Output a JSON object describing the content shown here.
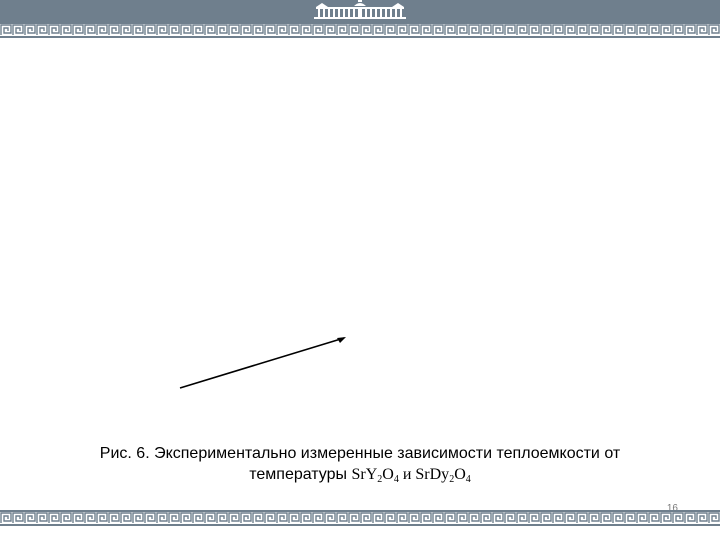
{
  "slide": {
    "caption_line1": "Рис. 6. Экспериментально измеренные зависимости теплоемкости от",
    "caption_line2_prefix": "температуры ",
    "formula1": {
      "el1": "Sr",
      "el2": "Y",
      "n1": "2",
      "el3": "O",
      "n2": "4"
    },
    "conjunction": " и ",
    "formula2": {
      "el1": "Sr",
      "el2": "Dy",
      "n1": "2",
      "el3": "O",
      "n2": "4"
    },
    "page_number": "16"
  },
  "decor": {
    "band_color": "#6f7f8d",
    "logo": "university-building-logo",
    "border_pattern": "greek-key-meander",
    "pointer": "arrow-line"
  }
}
